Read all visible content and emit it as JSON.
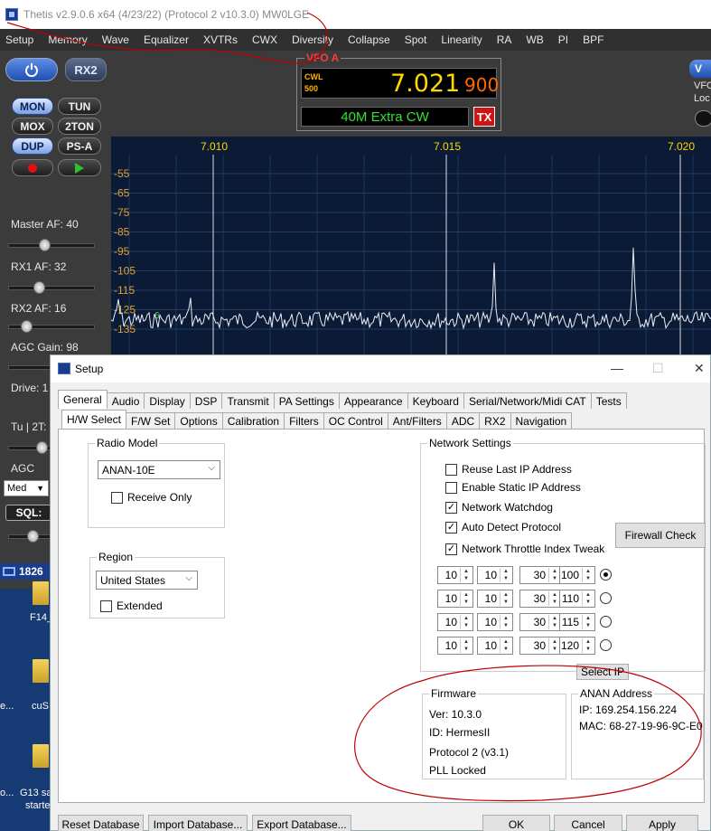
{
  "main_window": {
    "title": "Thetis v2.9.0.6 x64 (4/23/22) (Protocol 2 v10.3.0) MW0LGE",
    "menu": [
      "Setup",
      "Memory",
      "Wave",
      "Equalizer",
      "XVTRs",
      "CWX",
      "Diversity",
      "Collapse",
      "Spot",
      "Linearity",
      "RA",
      "WB",
      "PI",
      "BPF"
    ]
  },
  "left_panel": {
    "rx2": "RX2",
    "buttons": {
      "mon": "MON",
      "tun": "TUN",
      "mox": "MOX",
      "twotone": "2TON",
      "dup": "DUP",
      "psa": "PS-A"
    },
    "master_af": "Master AF:  40",
    "rx1_af": "RX1 AF:  32",
    "rx2_af": "RX2 AF:  16",
    "agc_gain": "AGC Gain:  98",
    "drive": "Drive:  1",
    "tu2t": "Tu | 2T:",
    "agc": "AGC",
    "agc_mode": "Med",
    "sql": "SQL:",
    "cpu": "1826",
    "levels": {
      "master_af": 40,
      "rx1_af": 32,
      "rx2_af": 16
    }
  },
  "vfo": {
    "label": "VFO A",
    "mode_line1": "CWL",
    "mode_line2": "500",
    "freq": "7.021",
    "subfreq": "900",
    "band": "40M Extra CW",
    "tx": "TX",
    "vfo_b": "V",
    "side1": "VFO",
    "side2": "Loc"
  },
  "spectrum": {
    "freq_labels": [
      "7.010",
      "7.015",
      "7.020"
    ],
    "db_labels": [
      "-55",
      "-65",
      "-75",
      "-85",
      "-95",
      "-105",
      "-115",
      "-125",
      "-135"
    ],
    "marker": "6"
  },
  "desktop": {
    "items": [
      "F14_",
      "cuS",
      "e...",
      "G13 sa",
      "starte",
      "o..."
    ]
  },
  "setup": {
    "title": "Setup",
    "window_controls": {
      "minimize": "—",
      "maximize": "☐",
      "close": "✕"
    },
    "tabs_top": [
      "General",
      "Audio",
      "Display",
      "DSP",
      "Transmit",
      "PA Settings",
      "Appearance",
      "Keyboard",
      "Serial/Network/Midi CAT",
      "Tests"
    ],
    "tabs_sub": [
      "H/W Select",
      "F/W Set",
      "Options",
      "Calibration",
      "Filters",
      "OC Control",
      "Ant/Filters",
      "ADC",
      "RX2",
      "Navigation"
    ],
    "radio_model": {
      "label": "Radio Model",
      "value": "ANAN-10E",
      "receive_only": "Receive Only"
    },
    "region": {
      "label": "Region",
      "value": "United States",
      "extended": "Extended"
    },
    "network": {
      "label": "Network Settings",
      "reuse_last_ip": {
        "label": "Reuse Last IP Address",
        "checked": false
      },
      "enable_static_ip": {
        "label": "Enable Static IP Address",
        "checked": false
      },
      "network_watchdog": {
        "label": "Network Watchdog",
        "checked": true
      },
      "auto_detect_protocol": {
        "label": "Auto Detect Protocol",
        "checked": true
      },
      "network_throttle": {
        "label": "Network Throttle Index Tweak",
        "checked": true
      },
      "firewall_check": "Firewall Check",
      "ip_rows": [
        [
          "10",
          "10",
          "30",
          "100"
        ],
        [
          "10",
          "10",
          "30",
          "110"
        ],
        [
          "10",
          "10",
          "30",
          "115"
        ],
        [
          "10",
          "10",
          "30",
          "120"
        ]
      ],
      "selected_row": 0,
      "select_ip": "Select IP"
    },
    "firmware": {
      "label": "Firmware",
      "ver": "Ver:  10.3.0",
      "id": "ID:   HermesII",
      "protocol": "Protocol 2 (v3.1)",
      "pll": "PLL Locked"
    },
    "anan_address": {
      "label": "ANAN Address",
      "ip": "IP:     169.254.156.224",
      "mac": "MAC:  68-27-19-96-9C-E0"
    },
    "footer": {
      "reset_db": "Reset Database",
      "import_db": "Import Database...",
      "export_db": "Export Database...",
      "ok": "OK",
      "cancel": "Cancel",
      "apply": "Apply"
    }
  }
}
